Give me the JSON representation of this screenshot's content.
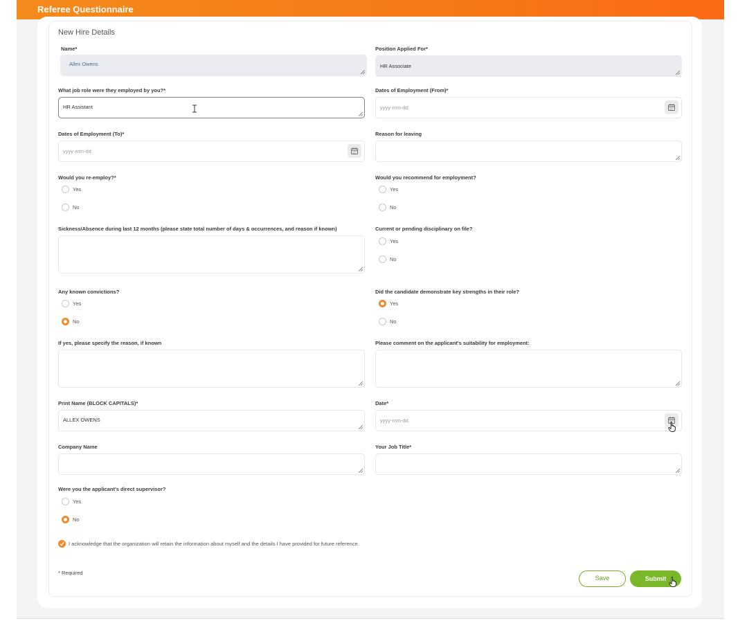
{
  "header": {
    "title": "Referee Questionnaire"
  },
  "section_title": "New Hire Details",
  "fields": {
    "name": {
      "label": "Name*",
      "value": "Allex Owens"
    },
    "position": {
      "label": "Position Applied For*",
      "value": "HR Associate"
    },
    "job_role": {
      "label": "What job role were they employed by you?*",
      "value": "HR Assistant"
    },
    "date_from": {
      "label": "Dates of Employment (From)*",
      "placeholder": "yyyy-mm-dd"
    },
    "date_to": {
      "label": "Dates of Employment (To)*",
      "placeholder": "yyyy-mm-dd"
    },
    "reason_leaving": {
      "label": "Reason for leaving",
      "value": ""
    },
    "sickness": {
      "label": "Sickness/Absence during last 12 months (please state total number of days & occurrences, and reason if known)",
      "value": ""
    },
    "conviction_reason": {
      "label": "If yes, please specify the reason, if known",
      "value": ""
    },
    "suitability": {
      "label": "Please comment on the applicant's suitability for employment:",
      "value": ""
    },
    "print_name": {
      "label": "Print Name (BLOCK CAPITALS)*",
      "value": "ALLEX OWENS"
    },
    "date": {
      "label": "Date*",
      "placeholder": "yyyy-mm-dd"
    },
    "company": {
      "label": "Company Name",
      "value": ""
    },
    "job_title": {
      "label": "Your Job Title*",
      "value": ""
    }
  },
  "radio_groups": {
    "reemploy": {
      "label": "Would you re-employ?*",
      "options": [
        "Yes",
        "No"
      ],
      "selected": null
    },
    "recommend": {
      "label": "Would you recommend for employment?",
      "options": [
        "Yes",
        "No"
      ],
      "selected": null
    },
    "disciplinary": {
      "label": "Current or pending disciplinary on file?",
      "options": [
        "Yes",
        "No"
      ],
      "selected": null
    },
    "convictions": {
      "label": "Any known convictions?",
      "options": [
        "Yes",
        "No"
      ],
      "selected": "No"
    },
    "strengths": {
      "label": "Did the candidate demonstrate key strengths in their role?",
      "options": [
        "Yes",
        "No"
      ],
      "selected": "Yes"
    },
    "supervisor": {
      "label": "Were you the applicant's direct supervisor?",
      "options": [
        "Yes",
        "No"
      ],
      "selected": "No"
    }
  },
  "acknowledgement": {
    "text": "I acknowledge that the organization will retain the information about myself and the details I have provided for future reference.",
    "checked": true
  },
  "required_note": "* Required",
  "buttons": {
    "save": "Save",
    "submit": "Submit"
  },
  "colors": {
    "header_start": "#f58a1c",
    "header_end": "#fb6a14",
    "accent": "#f28a2c",
    "submit": "#7ab829"
  },
  "icons": [
    "calendar-icon",
    "resize-handle-icon",
    "check-icon",
    "text-cursor-icon",
    "hand-pointer-icon"
  ]
}
